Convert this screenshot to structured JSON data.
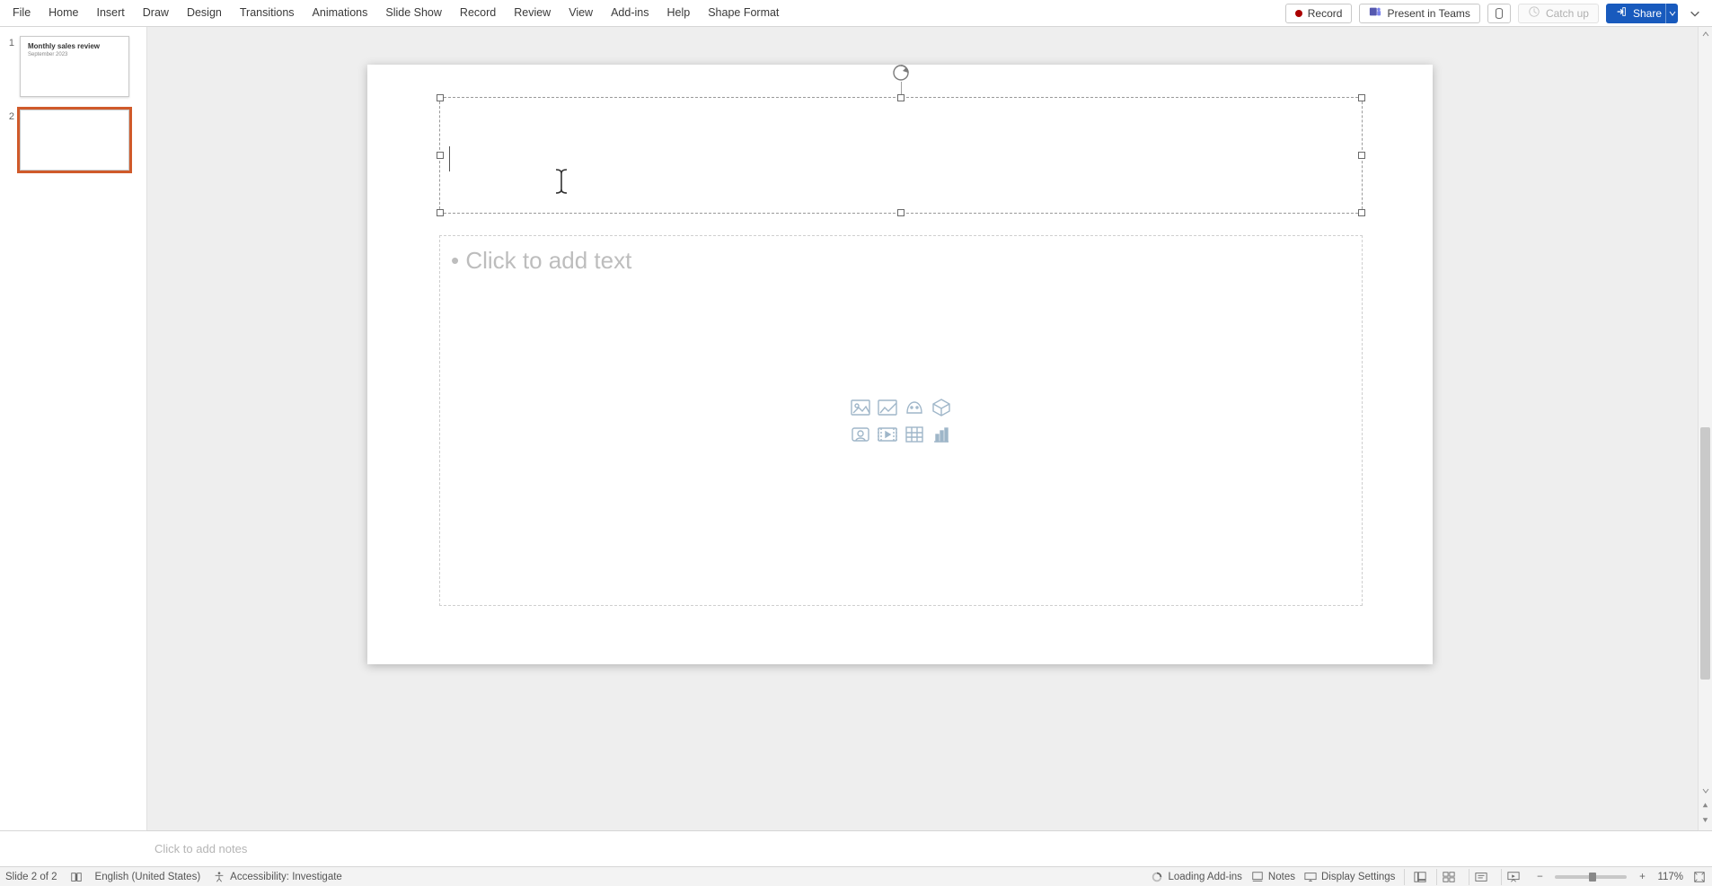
{
  "ribbon": {
    "tabs": [
      "File",
      "Home",
      "Insert",
      "Draw",
      "Design",
      "Transitions",
      "Animations",
      "Slide Show",
      "Record",
      "Review",
      "View",
      "Add-ins",
      "Help",
      "Shape Format"
    ],
    "record_label": "Record",
    "present_label": "Present in Teams",
    "catch_up_label": "Catch up",
    "share_label": "Share"
  },
  "slides": {
    "items": [
      {
        "num": "1",
        "title": "Monthly sales review",
        "subtitle": "September 2023"
      },
      {
        "num": "2",
        "title": "",
        "subtitle": ""
      }
    ]
  },
  "content_placeholder": {
    "text": "Click to add text",
    "icons": [
      "stock-images",
      "pictures",
      "icons",
      "3d-models",
      "cameo",
      "video",
      "table",
      "chart"
    ]
  },
  "notes": {
    "placeholder": "Click to add notes"
  },
  "statusbar": {
    "slide_pos": "Slide 2 of 2",
    "language": "English (United States)",
    "accessibility": "Accessibility: Investigate",
    "loading": "Loading Add-ins",
    "notes_label": "Notes",
    "display_label": "Display Settings",
    "zoom_value": "117%"
  }
}
